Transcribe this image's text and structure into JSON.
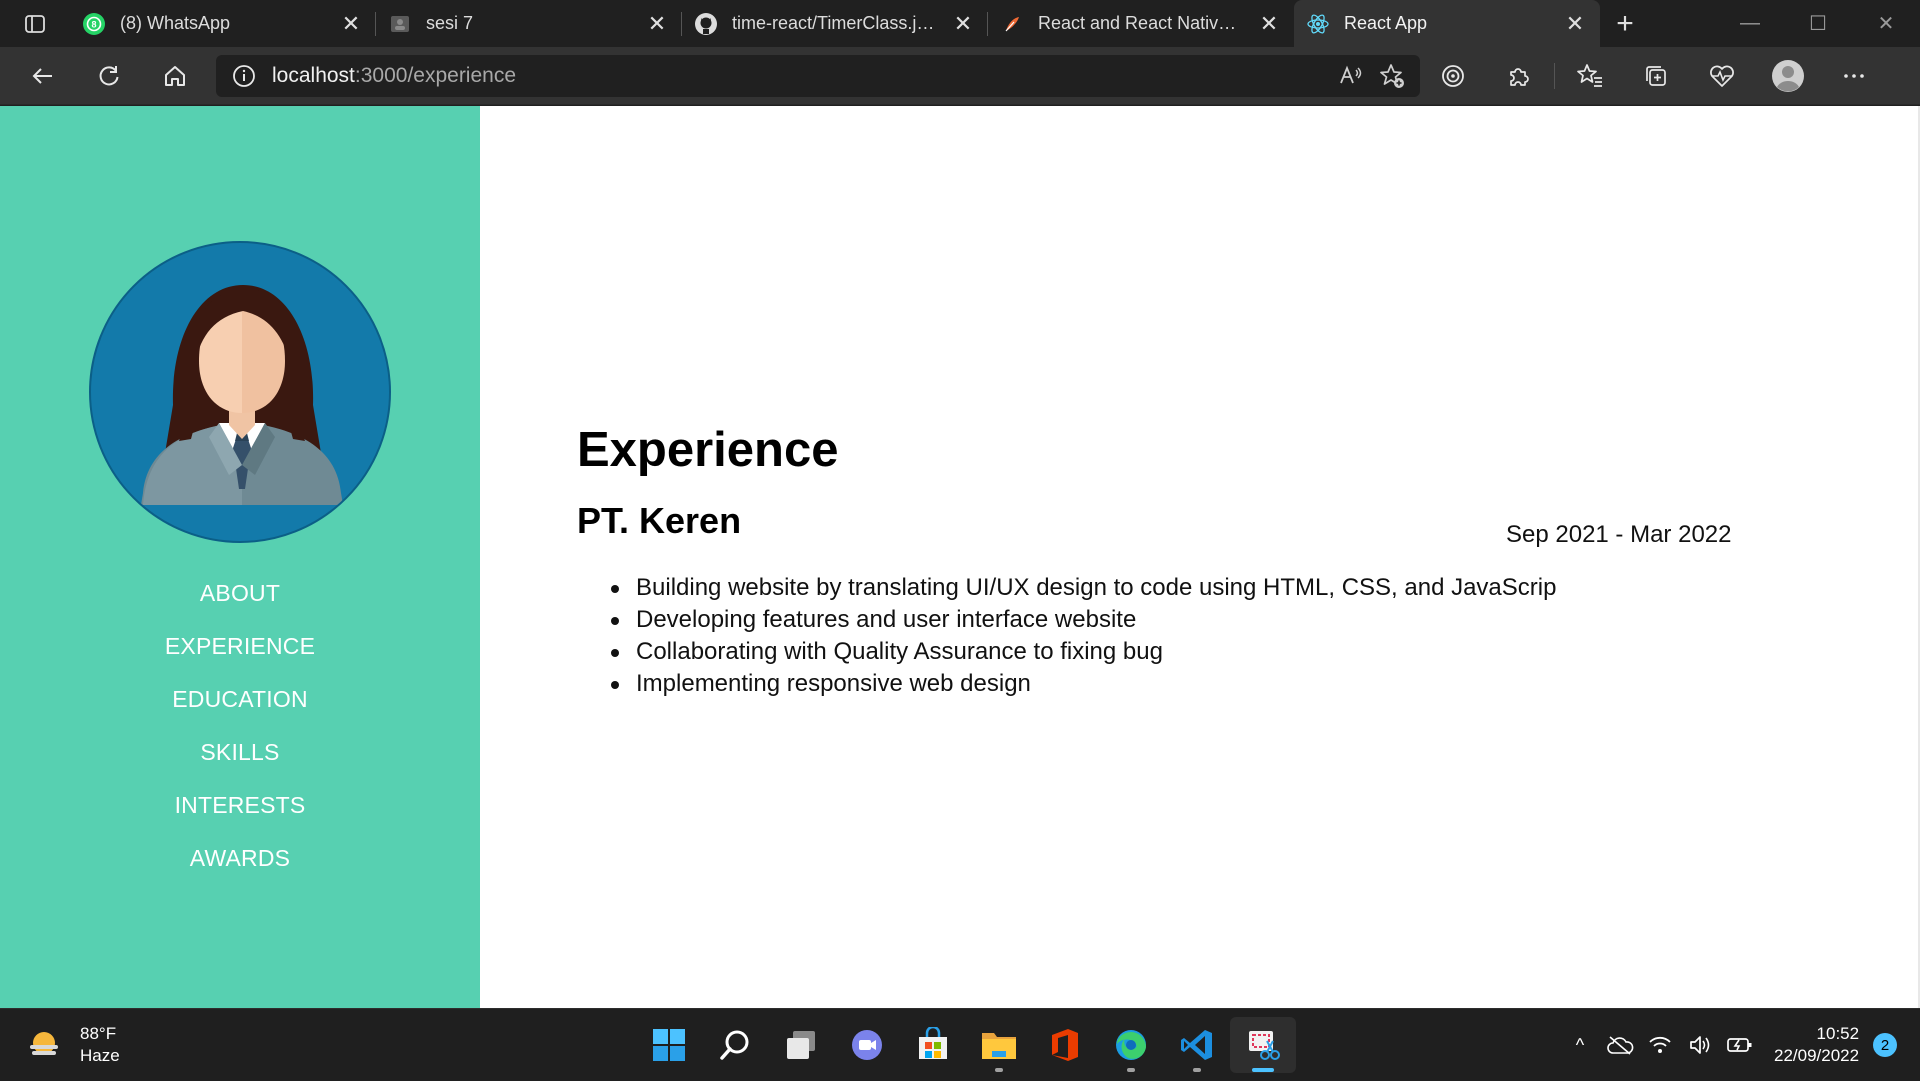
{
  "browser": {
    "tabs": [
      {
        "title": "(8) WhatsApp",
        "icon": "whatsapp-icon",
        "active": false
      },
      {
        "title": "sesi 7",
        "icon": "generic-page-icon",
        "active": false
      },
      {
        "title": "time-react/TimerClass.js at",
        "icon": "github-icon",
        "active": false
      },
      {
        "title": "React and React Native Ba",
        "icon": "feather-icon",
        "active": false
      },
      {
        "title": "React App",
        "icon": "react-icon",
        "active": true
      }
    ],
    "new_tab_label": "+",
    "close_glyph": "✕",
    "window_controls": {
      "minimize": "—",
      "maximize": "☐",
      "close": "✕"
    },
    "address": {
      "host": "localhost",
      "path": ":3000/experience"
    }
  },
  "sidebar": {
    "bg_color": "#57d0b1",
    "avatar_bg": "#137aaa",
    "nav": [
      "ABOUT",
      "EXPERIENCE",
      "EDUCATION",
      "SKILLS",
      "INTERESTS",
      "AWARDS"
    ]
  },
  "main": {
    "heading": "Experience",
    "company": "PT. Keren",
    "period": "Sep 2021 - Mar 2022",
    "bullets": [
      "Building website by translating UI/UX design to code using HTML, CSS, and JavaScrip",
      "Developing features and user interface website",
      "Collaborating with Quality Assurance to fixing bug",
      "Implementing responsive web design"
    ]
  },
  "taskbar": {
    "weather": {
      "temp": "88°F",
      "condition": "Haze",
      "icon": "weather-haze-icon"
    },
    "apps": [
      "start-icon",
      "search-icon",
      "task-view-icon",
      "chat-icon",
      "store-icon",
      "file-explorer-icon",
      "office-icon",
      "edge-icon",
      "vscode-icon",
      "snipping-tool-icon"
    ],
    "tray_chevron": "^",
    "time": "10:52",
    "date": "22/09/2022",
    "notifications": "2"
  }
}
